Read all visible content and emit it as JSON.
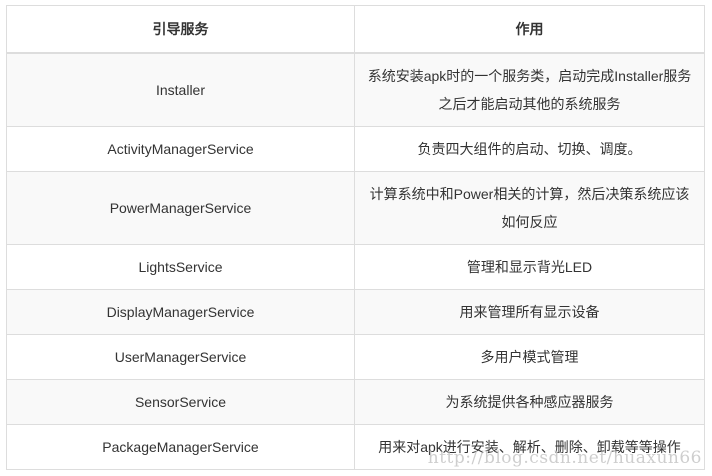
{
  "table": {
    "headers": [
      "引导服务",
      "作用"
    ],
    "rows": [
      {
        "service": "Installer",
        "role": "系统安装apk时的一个服务类，启动完成Installer服务之后才能启动其他的系统服务"
      },
      {
        "service": "ActivityManagerService",
        "role": "负责四大组件的启动、切换、调度。"
      },
      {
        "service": "PowerManagerService",
        "role": "计算系统中和Power相关的计算，然后决策系统应该如何反应"
      },
      {
        "service": "LightsService",
        "role": "管理和显示背光LED"
      },
      {
        "service": "DisplayManagerService",
        "role": "用来管理所有显示设备"
      },
      {
        "service": "UserManagerService",
        "role": "多用户模式管理"
      },
      {
        "service": "SensorService",
        "role": "为系统提供各种感应器服务"
      },
      {
        "service": "PackageManagerService",
        "role": "用来对apk进行安装、解析、删除、卸载等等操作"
      }
    ]
  },
  "watermark": "http://blog.csdn.net/huaxun66"
}
